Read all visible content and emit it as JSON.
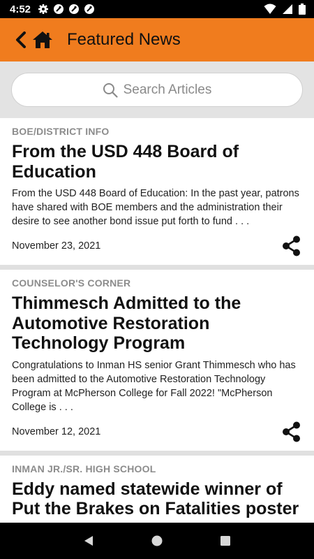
{
  "status_bar": {
    "time": "4:52"
  },
  "header": {
    "title": "Featured News"
  },
  "search": {
    "placeholder": "Search Articles"
  },
  "articles": [
    {
      "category": "BOE/DISTRICT INFO",
      "headline": "From the USD 448 Board of Education",
      "summary": "From the USD 448 Board of Education: In the past year, patrons have shared with BOE members and the administration their desire to see another bond issue put forth to fund . . .",
      "date": "November 23, 2021"
    },
    {
      "category": "COUNSELOR'S CORNER",
      "headline": "Thimmesch Admitted to the Automotive Restoration Technology Program",
      "summary": "Congratulations to Inman HS senior Grant Thimmesch who has been admitted to the Automotive Restoration Technology Program at McPherson College for Fall 2022! \"McPherson College is . . .",
      "date": "November 12, 2021"
    },
    {
      "category": "INMAN JR./SR. HIGH SCHOOL",
      "headline": "Eddy named statewide winner of Put the Brakes on Fatalities poster",
      "summary": "",
      "date": ""
    }
  ],
  "icons": {
    "back": "chevron-left-icon",
    "home": "home-icon",
    "search": "search-icon",
    "share": "share-icon"
  },
  "colors": {
    "accent": "#f07c1e"
  }
}
